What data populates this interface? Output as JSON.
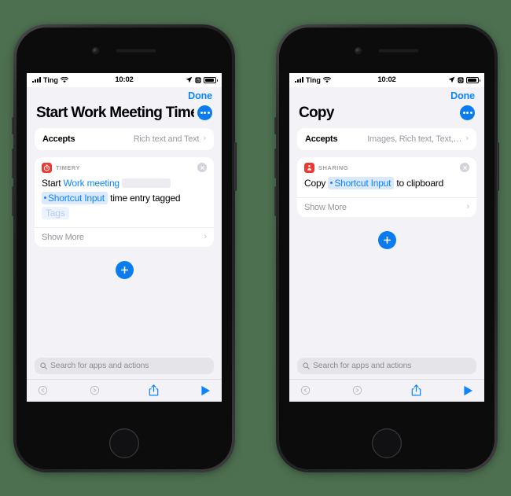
{
  "background_color": "#4d7050",
  "accent_color": "#0a84ff",
  "phones": [
    {
      "id": "left",
      "status_bar": {
        "carrier": "Ting",
        "time": "10:02",
        "signal_icon": "cellular-signal-icon",
        "wifi_icon": "wifi-icon",
        "location_icon": "location-arrow-icon",
        "alarm_icon": "alarm-clock-icon",
        "battery_icon": "battery-icon"
      },
      "nav": {
        "done_label": "Done"
      },
      "title": "Start Work Meeting Timer",
      "more_button": "more-options-icon",
      "accepts": {
        "label": "Accepts",
        "value": "Rich text and Text",
        "chevron": "›"
      },
      "action": {
        "app_name": "TIMERY",
        "app_icon": "timery-stopwatch-icon",
        "app_icon_color": "#eb3b30",
        "close_icon": "close-circle-icon",
        "tokens": [
          {
            "type": "plain",
            "text": "Start"
          },
          {
            "type": "link",
            "text": "Work meeting"
          },
          {
            "type": "empty",
            "text": ""
          },
          {
            "type": "var",
            "text": "Shortcut Input"
          },
          {
            "type": "plain",
            "text": "time entry"
          },
          {
            "type": "plain",
            "text": "tagged"
          },
          {
            "type": "placeholder",
            "text": "Tags"
          }
        ],
        "show_more_label": "Show More",
        "show_more_chevron": "›"
      },
      "add_button": "add-action-icon",
      "search": {
        "placeholder": "Search for apps and actions",
        "icon": "search-icon"
      },
      "toolbar": {
        "undo": "undo-icon",
        "redo": "redo-icon",
        "share": "share-icon",
        "play": "play-icon"
      }
    },
    {
      "id": "right",
      "status_bar": {
        "carrier": "Ting",
        "time": "10:02",
        "signal_icon": "cellular-signal-icon",
        "wifi_icon": "wifi-icon",
        "location_icon": "location-arrow-icon",
        "alarm_icon": "alarm-clock-icon",
        "battery_icon": "battery-icon"
      },
      "nav": {
        "done_label": "Done"
      },
      "title": "Copy",
      "more_button": "more-options-icon",
      "accepts": {
        "label": "Accepts",
        "value": "Images, Rich text, Text,…",
        "chevron": "›"
      },
      "action": {
        "app_name": "SHARING",
        "app_icon": "sharing-icon",
        "app_icon_color": "#eb3b30",
        "close_icon": "close-circle-icon",
        "tokens": [
          {
            "type": "plain",
            "text": "Copy"
          },
          {
            "type": "var",
            "text": "Shortcut Input"
          },
          {
            "type": "plain",
            "text": "to"
          },
          {
            "type": "plain",
            "text": "clipboard"
          }
        ],
        "show_more_label": "Show More",
        "show_more_chevron": "›"
      },
      "add_button": "add-action-icon",
      "search": {
        "placeholder": "Search for apps and actions",
        "icon": "search-icon"
      },
      "toolbar": {
        "undo": "undo-icon",
        "redo": "redo-icon",
        "share": "share-icon",
        "play": "play-icon"
      }
    }
  ]
}
